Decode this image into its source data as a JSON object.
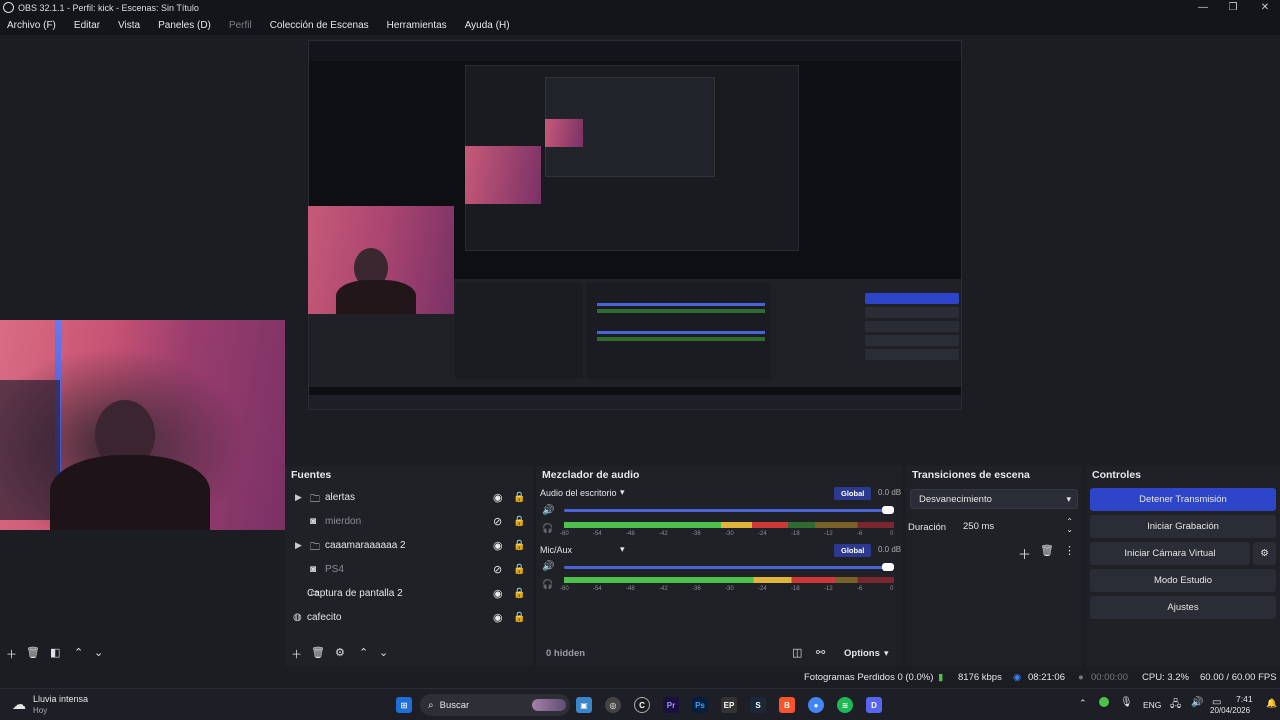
{
  "window": {
    "title": "OBS 32.1.1 - Perfil: kick - Escenas: Sin Título"
  },
  "menu": [
    "Archivo (F)",
    "Editar",
    "Vista",
    "Paneles (D)",
    "Perfil",
    "Colección de Escenas",
    "Herramientas",
    "Ayuda (H)"
  ],
  "fuentes": {
    "title": "Fuentes",
    "items": [
      {
        "label": "alertas",
        "icon": "folder-icon",
        "expandable": true,
        "visible": true,
        "dim": false
      },
      {
        "label": "mierdon",
        "icon": "camera-icon",
        "expandable": false,
        "visible": false,
        "dim": true
      },
      {
        "label": "caaamaraaaaaa 2",
        "icon": "folder-icon",
        "expandable": true,
        "visible": true,
        "dim": false
      },
      {
        "label": "PS4",
        "icon": "camera-icon",
        "expandable": false,
        "visible": false,
        "dim": true
      },
      {
        "label": "Captura de pantalla 2",
        "icon": "monitor-icon",
        "expandable": false,
        "visible": true,
        "dim": false
      },
      {
        "label": "cafecito",
        "icon": "globe-icon",
        "expandable": false,
        "visible": true,
        "dim": false
      }
    ]
  },
  "mixer": {
    "title": "Mezclador de audio",
    "channels": [
      {
        "name": "Audio del escritorio",
        "badge": "Global",
        "db": "0.0 dB",
        "volume": 1.0,
        "level": 0.68
      },
      {
        "name": "Mic/Aux",
        "badge": "Global",
        "db": "0.0 dB",
        "volume": 1.0,
        "level": 0.82
      }
    ],
    "scale": [
      "-60",
      "-54",
      "-48",
      "-42",
      "-36",
      "-30",
      "-24",
      "-18",
      "-12",
      "-6",
      "0"
    ],
    "hidden": "0 hidden",
    "options": "Options"
  },
  "transitions": {
    "title": "Transiciones de escena",
    "selected": "Desvanecimiento",
    "duration_label": "Duración",
    "duration": "250 ms"
  },
  "controls": {
    "title": "Controles",
    "stream": "Detener Transmisión",
    "record": "Iniciar Grabación",
    "vcam": "Iniciar Cámara Virtual",
    "studio": "Modo Estudio",
    "settings": "Ajustes"
  },
  "status": {
    "dropped": "Fotogramas Perdidos 0 (0.0%)",
    "bitrate": "8176 kbps",
    "stream_time": "08:21:06",
    "rec_time": "00:00:00",
    "cpu": "CPU: 3.2%",
    "fps": "60.00 / 60.00 FPS"
  },
  "taskbar": {
    "weather_title": "Lluvia intensa",
    "weather_sub": "Hoy",
    "search": "Buscar",
    "lang": "ENG",
    "time": "7:41",
    "date": "20/04/2026"
  },
  "colors": {
    "accent": "#2d45c9",
    "panel": "#1f2127",
    "bg": "#1b1d22"
  }
}
